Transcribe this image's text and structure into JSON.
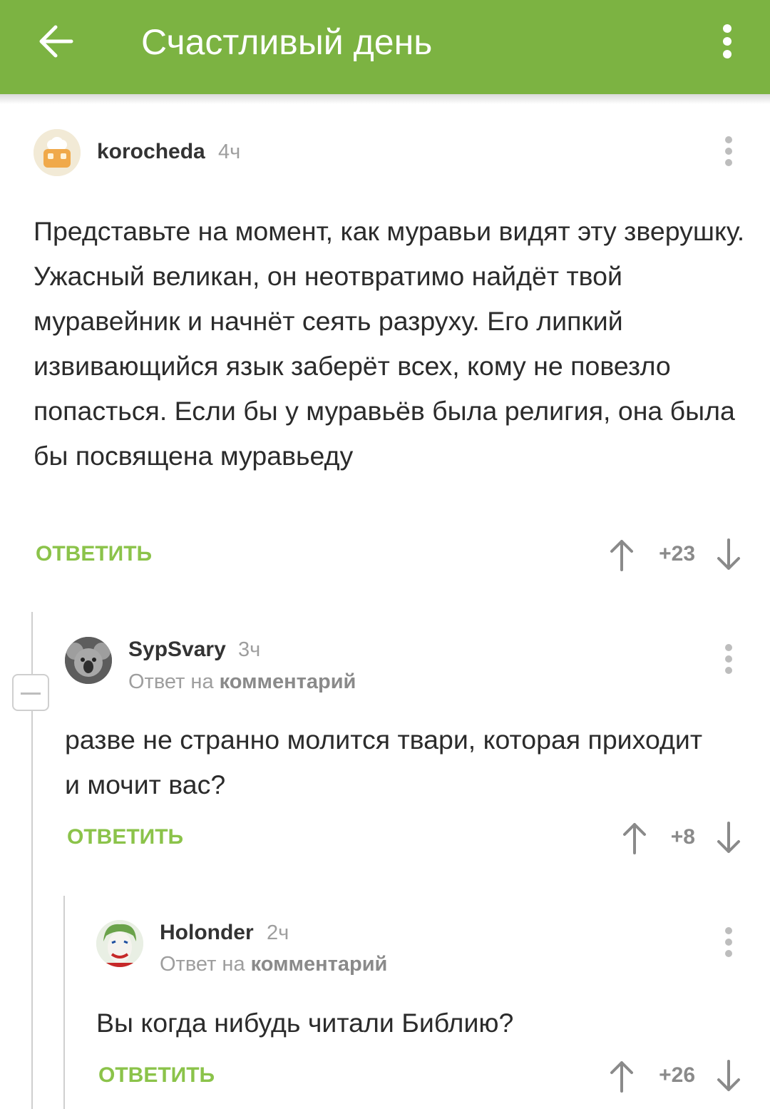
{
  "appbar": {
    "title": "Счастливый день",
    "back_icon": "arrow-left-icon",
    "menu_icon": "vertical-dots-icon",
    "color": "#7cb342"
  },
  "comments": [
    {
      "author": "korocheda",
      "time": "4ч",
      "text": "Представьте на момент, как муравьи видят эту зверушку. Ужасный великан, он неотвратимо найдёт твой муравейник и начнёт сеять разруху. Его липкий извивающийся язык заберёт всех, кому не повезло попасться. Если бы у муравьёв была религия, она была бы посвящена муравьеду",
      "reply_label": "ОТВЕТИТЬ",
      "rating": "+23"
    },
    {
      "author": "SypSvary",
      "time": "3ч",
      "reply_prefix": "Ответ на",
      "reply_target": "комментарий",
      "text": "разве не странно молится твари, которая приходит и мочит вас?",
      "reply_label": "ОТВЕТИТЬ",
      "rating": "+8"
    },
    {
      "author": "Holonder",
      "time": "2ч",
      "reply_prefix": "Ответ на",
      "reply_target": "комментарий",
      "text": "Вы когда нибудь читали Библию?",
      "reply_label": "ОТВЕТИТЬ",
      "rating": "+26"
    }
  ],
  "accent_color": "#8bc34a"
}
